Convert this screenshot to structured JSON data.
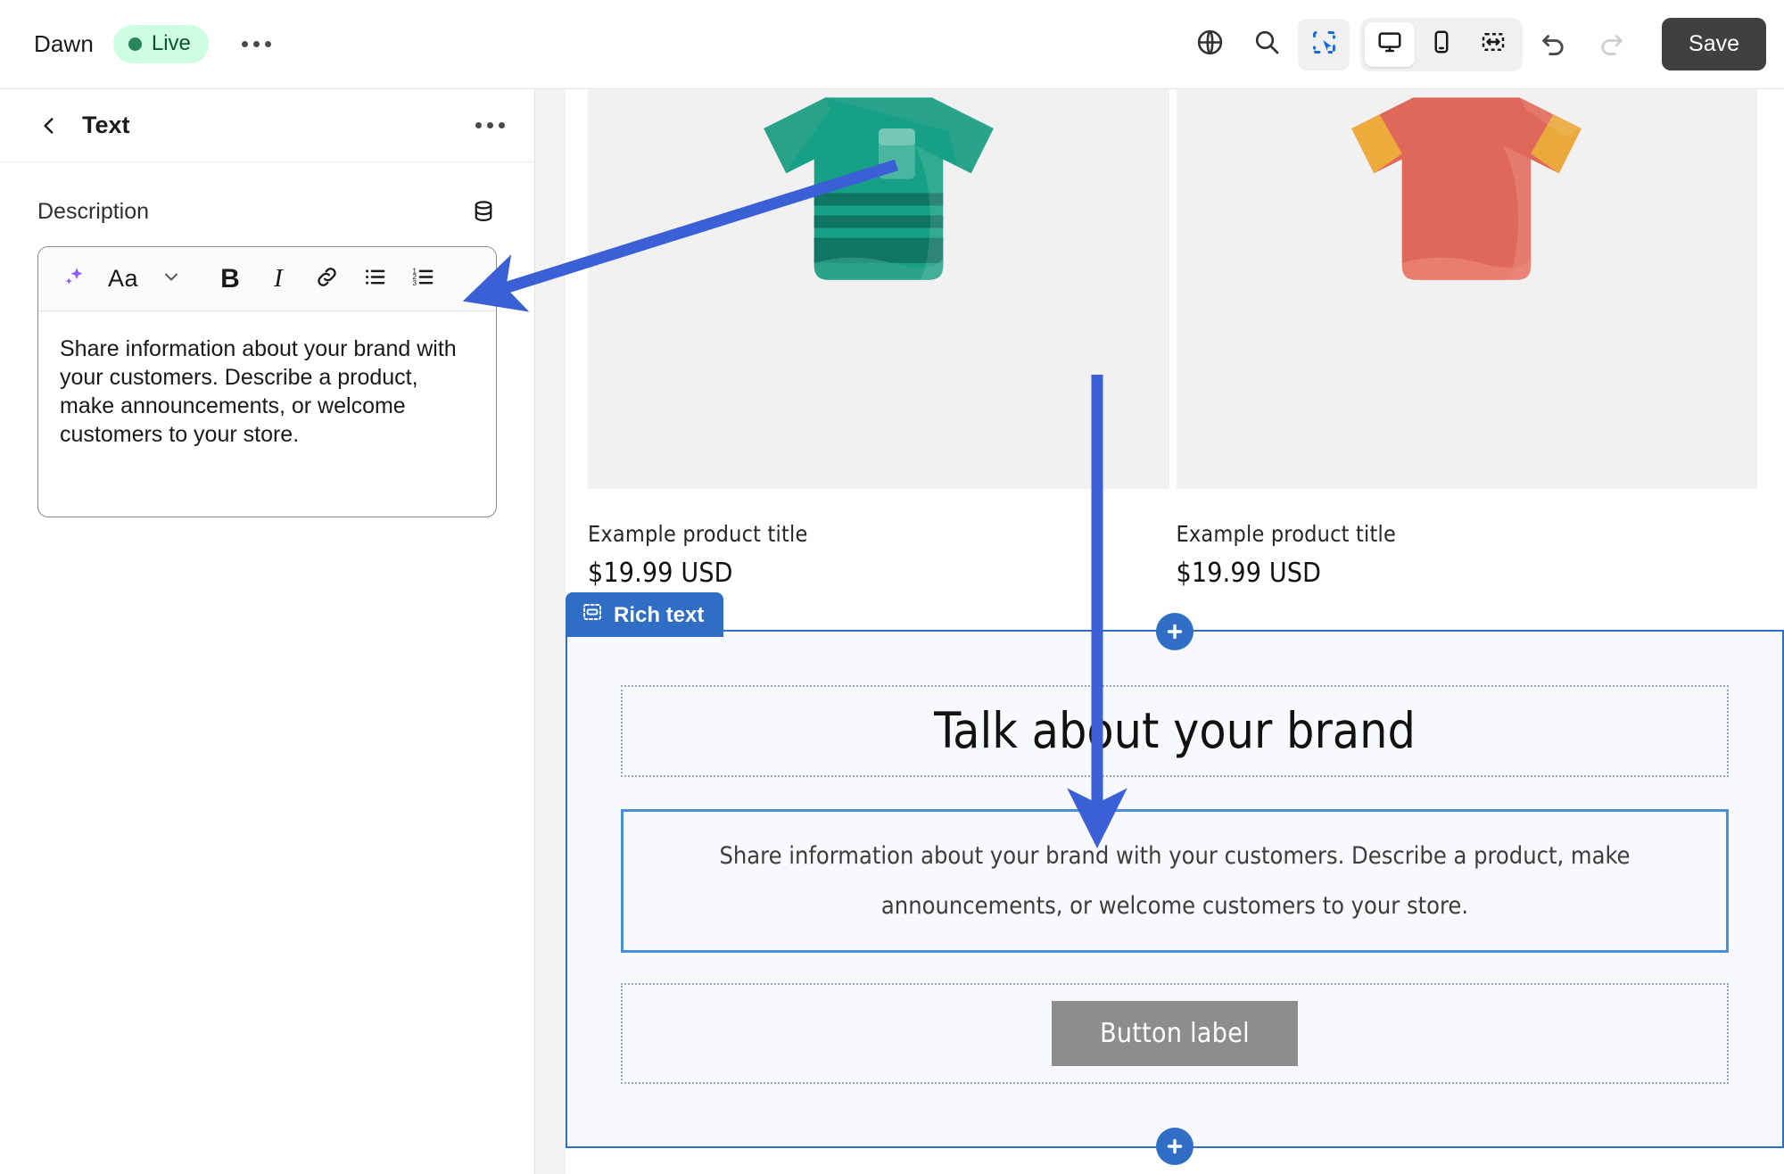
{
  "topbar": {
    "theme_name": "Dawn",
    "status_badge": "Live",
    "more_menu_label": "...",
    "icons": {
      "globe": "globe-icon",
      "search": "search-icon",
      "inspector": "inspector-select-icon",
      "desktop": "desktop-icon",
      "mobile": "mobile-icon",
      "fullwidth": "full-width-icon",
      "undo": "undo-icon",
      "redo": "redo-icon"
    },
    "save_label": "Save"
  },
  "sidebar": {
    "panel_title": "Text",
    "back_label": "Back",
    "more_label": "...",
    "description": {
      "label": "Description",
      "metafield_icon": "database-icon",
      "value": "Share information about your brand with your customers. Describe a product, make announcements, or welcome customers to your store.",
      "toolbar": [
        {
          "name": "ai-sparkle-icon",
          "label": ""
        },
        {
          "name": "text-style-icon",
          "label": "Aa"
        },
        {
          "name": "chevron-down-icon",
          "label": ""
        },
        {
          "name": "bold-icon",
          "label": "B"
        },
        {
          "name": "italic-icon",
          "label": "I"
        },
        {
          "name": "link-icon",
          "label": ""
        },
        {
          "name": "bulleted-list-icon",
          "label": ""
        },
        {
          "name": "numbered-list-icon",
          "label": ""
        }
      ]
    }
  },
  "preview": {
    "products": [
      {
        "title": "Example product title",
        "price": "$19.99 USD",
        "shirt_color": "#16a085",
        "trim_color": "#3aa58f"
      },
      {
        "title": "Example product title",
        "price": "$19.99 USD",
        "shirt_color": "#e0685a",
        "trim_color": "#eeab3c"
      }
    ],
    "section": {
      "tab_label": "Rich text",
      "tab_icon": "section-block-icon",
      "heading": "Talk about your brand",
      "paragraph": "Share information about your brand with your customers. Describe a product, make announcements, or welcome customers to your store.",
      "button_label": "Button label",
      "add_block_label": "+"
    }
  },
  "colors": {
    "accent_blue": "#2f6ec4",
    "annotation_blue": "#3b5fd4",
    "selected_border": "#4a90d9",
    "save_bg": "#404040",
    "live_bg": "#cdfee1",
    "live_text": "#0c5132"
  }
}
